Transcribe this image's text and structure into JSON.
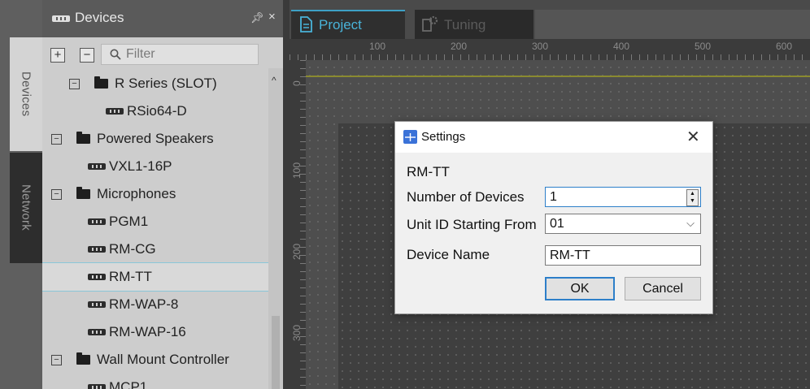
{
  "sidebar_tabs": {
    "devices": "Devices",
    "network": "Network"
  },
  "panel": {
    "title": "Devices",
    "expand_all": "+",
    "collapse_all": "−",
    "filter_placeholder": "Filter",
    "tree": [
      {
        "label": "R Series (SLOT)",
        "kind": "folder",
        "expander": "−"
      },
      {
        "label": "RSio64-D",
        "kind": "device"
      },
      {
        "label": "Powered Speakers",
        "kind": "folder",
        "expander": "−"
      },
      {
        "label": "VXL1-16P",
        "kind": "device"
      },
      {
        "label": "Microphones",
        "kind": "folder",
        "expander": "−"
      },
      {
        "label": "PGM1",
        "kind": "device"
      },
      {
        "label": "RM-CG",
        "kind": "device"
      },
      {
        "label": "RM-TT",
        "kind": "device",
        "selected": true
      },
      {
        "label": "RM-WAP-8",
        "kind": "device"
      },
      {
        "label": "RM-WAP-16",
        "kind": "device"
      },
      {
        "label": "Wall Mount Controller",
        "kind": "folder",
        "expander": "−"
      },
      {
        "label": "MCP1",
        "kind": "device"
      }
    ]
  },
  "tabs": {
    "project": "Project",
    "tuning": "Tuning"
  },
  "ruler": {
    "x_labels": [
      "100",
      "200",
      "300",
      "400",
      "500",
      "600"
    ],
    "y_labels": [
      "0",
      "100",
      "200",
      "300"
    ]
  },
  "dialog": {
    "title": "Settings",
    "close": "✕",
    "device_type": "RM-TT",
    "number_label": "Number of Devices",
    "number_value": "1",
    "unit_label": "Unit ID Starting From",
    "unit_value": "01",
    "name_label": "Device Name",
    "name_value": "RM-TT",
    "ok": "OK",
    "cancel": "Cancel"
  },
  "colors": {
    "accent": "#3ea0c6",
    "focus": "#2d7fc9",
    "selection": "#8ac6d8"
  }
}
